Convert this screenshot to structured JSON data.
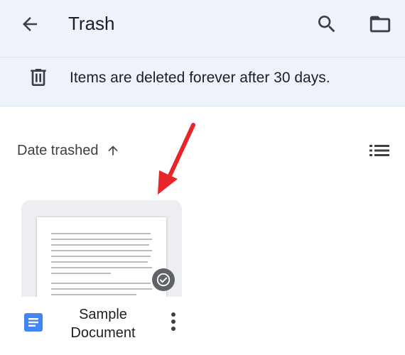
{
  "appbar": {
    "title": "Trash",
    "back_icon": "arrow-back-icon",
    "search_icon": "search-icon",
    "folder_icon": "folder-icon"
  },
  "banner": {
    "icon": "trash-icon",
    "message": "Items are deleted forever after 30 days."
  },
  "sort": {
    "label": "Date trashed",
    "direction_icon": "arrow-up-icon",
    "view_icon": "list-view-icon"
  },
  "files": [
    {
      "name_line1": "Sample",
      "name_line2": "Document",
      "type_icon": "google-docs-icon",
      "badge_icon": "shared-offline-badge-icon",
      "more_icon": "more-vert-icon"
    }
  ],
  "colors": {
    "appbar_bg": "#eef2fa",
    "docs_blue": "#4285f4",
    "annotation_red": "#e8252b"
  }
}
